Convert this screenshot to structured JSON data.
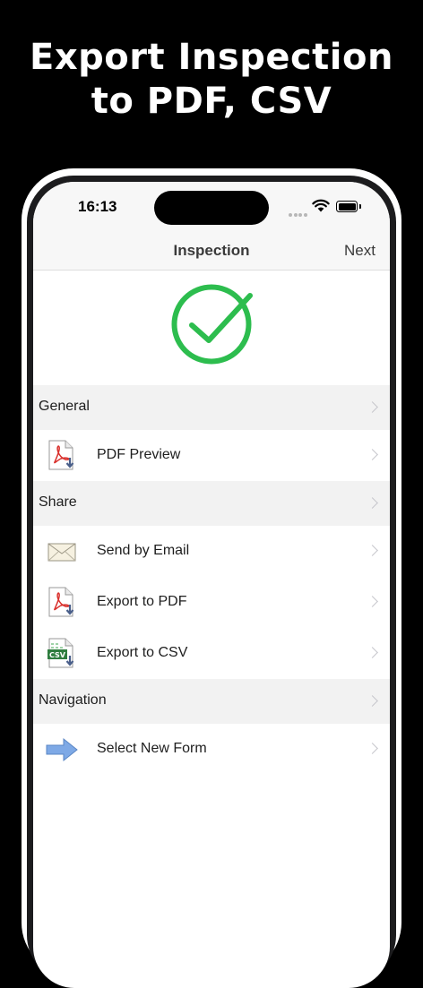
{
  "promo": {
    "line1": "Export Inspection",
    "line2": "to PDF, CSV"
  },
  "status_bar": {
    "time": "16:13"
  },
  "nav": {
    "title": "Inspection",
    "next_label": "Next"
  },
  "hero": {
    "icon": "checkmark-circle-icon",
    "color": "#2dbd4e"
  },
  "sections": [
    {
      "title": "General",
      "rows": [
        {
          "label": "PDF Preview",
          "icon": "pdf-file-icon"
        }
      ]
    },
    {
      "title": "Share",
      "rows": [
        {
          "label": "Send by Email",
          "icon": "envelope-icon"
        },
        {
          "label": "Export to PDF",
          "icon": "pdf-file-icon"
        },
        {
          "label": "Export to CSV",
          "icon": "csv-file-icon"
        }
      ]
    },
    {
      "title": "Navigation",
      "rows": [
        {
          "label": "Select New Form",
          "icon": "arrow-right-icon"
        }
      ]
    }
  ]
}
